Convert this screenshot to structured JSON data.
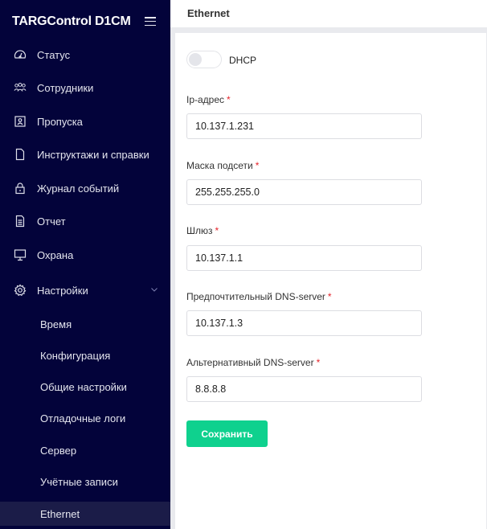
{
  "app": {
    "brand": "TARGControl D1CM"
  },
  "sidebar": {
    "items": [
      {
        "label": "Статус",
        "icon": "dashboard-icon"
      },
      {
        "label": "Сотрудники",
        "icon": "users-icon"
      },
      {
        "label": "Пропуска",
        "icon": "id-badge-icon"
      },
      {
        "label": "Инструктажи и справки",
        "icon": "document-icon"
      },
      {
        "label": "Журнал событий",
        "icon": "lock-icon"
      },
      {
        "label": "Отчет",
        "icon": "report-icon"
      },
      {
        "label": "Охрана",
        "icon": "monitor-icon"
      },
      {
        "label": "Настройки",
        "icon": "gear-icon",
        "expanded": true
      }
    ],
    "settings_sub": [
      {
        "label": "Время"
      },
      {
        "label": "Конфигурация"
      },
      {
        "label": "Общие настройки"
      },
      {
        "label": "Отладочные логи"
      },
      {
        "label": "Сервер"
      },
      {
        "label": "Учётные записи"
      },
      {
        "label": "Ethernet",
        "active": true
      }
    ]
  },
  "header": {
    "title": "Ethernet"
  },
  "form": {
    "dhcp": {
      "label": "DHCP",
      "enabled": false
    },
    "required_mark": "*",
    "fields": [
      {
        "label": "Ip-адрес",
        "value": "10.137.1.231"
      },
      {
        "label": "Маска подсети",
        "value": "255.255.255.0"
      },
      {
        "label": "Шлюз",
        "value": "10.137.1.1"
      },
      {
        "label": "Предпочтительный DNS-server",
        "value": "10.137.1.3"
      },
      {
        "label": "Альтернативный DNS-server",
        "value": "8.8.8.8"
      }
    ],
    "save_label": "Сохранить"
  },
  "colors": {
    "sidebar_bg": "#03033a",
    "active_item_bg": "#1b1c48",
    "accent": "#0fd18e",
    "required": "#e5242b"
  }
}
